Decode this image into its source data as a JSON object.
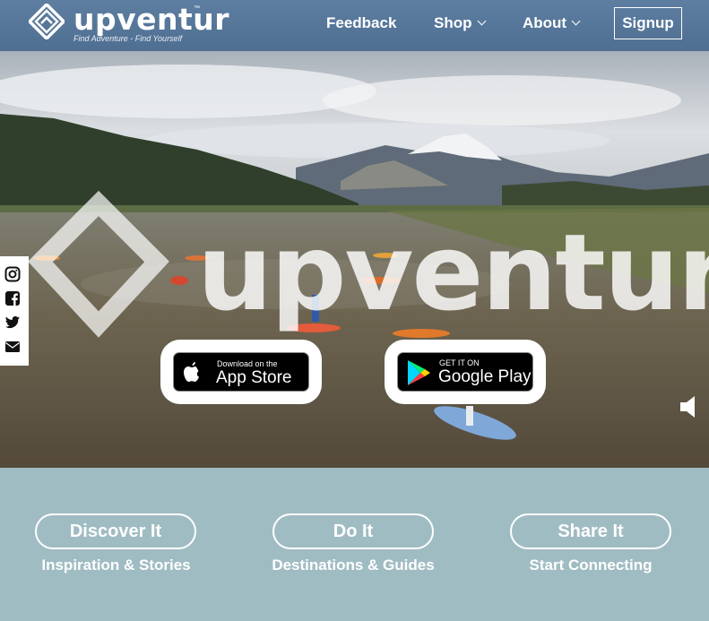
{
  "header": {
    "brand": "upventur",
    "brand_tm": "™",
    "tagline": "Find Adventure - Find Yourself",
    "nav": [
      {
        "label": "Feedback"
      },
      {
        "label": "Shop"
      },
      {
        "label": "About"
      }
    ],
    "signup_label": "Signup"
  },
  "hero": {
    "watermark_text": "upventur",
    "app_store": {
      "small": "Download on the",
      "big": "App Store"
    },
    "google_play": {
      "small": "GET IT ON",
      "big": "Google Play"
    }
  },
  "social": [
    "instagram-icon",
    "facebook-icon",
    "twitter-icon",
    "envelope-icon"
  ],
  "sections": [
    {
      "button": "Discover It",
      "subtitle": "Inspiration & Stories"
    },
    {
      "button": "Do It",
      "subtitle": "Destinations & Guides"
    },
    {
      "button": "Share It",
      "subtitle": "Start Connecting"
    }
  ],
  "colors": {
    "header": "#557596",
    "section_bg": "#a0bcc3",
    "white": "#ffffff"
  }
}
